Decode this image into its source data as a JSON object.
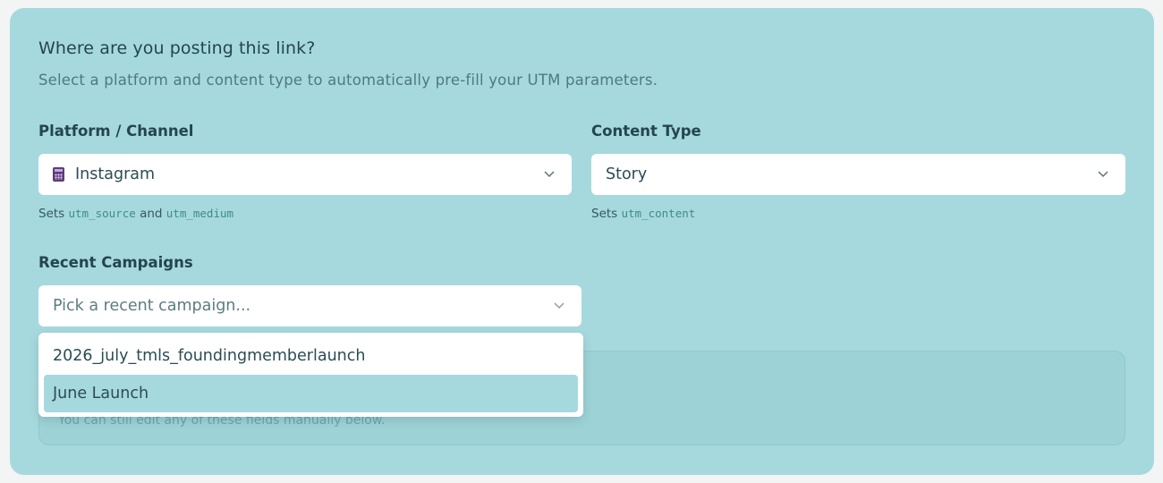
{
  "form": {
    "title": "Where are you posting this link?",
    "subtitle": "Select a platform and content type to automatically pre-fill your UTM parameters.",
    "platform": {
      "label": "Platform / Channel",
      "value": "Instagram",
      "icon": "calculator-icon",
      "hint_prefix": "Sets",
      "hint_code1": "utm_source",
      "hint_and": "and",
      "hint_code2": "utm_medium"
    },
    "content_type": {
      "label": "Content Type",
      "value": "Story",
      "hint_prefix": "Sets",
      "hint_code": "utm_content"
    },
    "recent_campaigns": {
      "label": "Recent Campaigns",
      "placeholder": "Pick a recent campaign...",
      "options": [
        "2026_july_tmls_foundingmemberlaunch",
        "June Launch"
      ],
      "highlighted_index": 1
    },
    "info_note": "You can still edit any of these fields manually below."
  },
  "colors": {
    "card_background": "#a6d9dd",
    "heading": "#24454f",
    "code_accent": "#3f8a90",
    "info_box": "#9dd3d7"
  }
}
